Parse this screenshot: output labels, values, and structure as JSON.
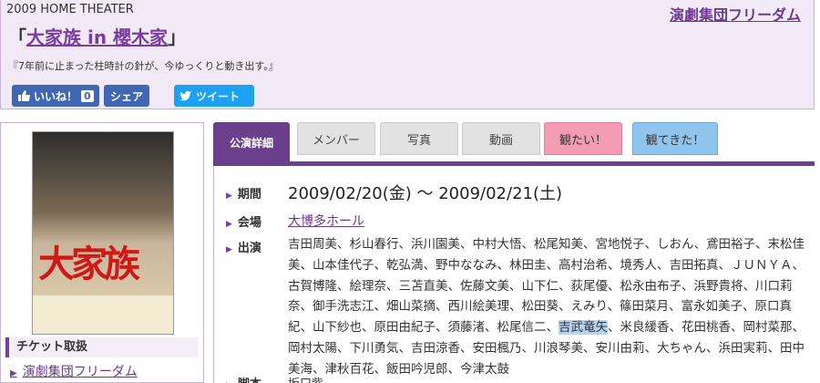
{
  "header": {
    "year_label": "2009 HOME THEATER",
    "title_open": "「",
    "title": "大家族 in 櫻木家",
    "title_close": "」",
    "tagline": "『7年前に止まった柱時計の針が、今ゆっくりと動き出す。』",
    "troupe_link": "演劇集団フリーダム"
  },
  "social": {
    "like_label": "いいね！",
    "like_count": "0",
    "share_label": "シェア",
    "tweet_label": "ツイート",
    "facebook_color": "#4267b2",
    "twitter_color": "#1da1f2"
  },
  "sidebar": {
    "ticket_heading": "チケット取扱",
    "ticket_link": "演劇集団フリーダム",
    "poster_text": "大家族"
  },
  "tabs": [
    {
      "label": "公演詳細"
    },
    {
      "label": "メンバー"
    },
    {
      "label": "写真"
    },
    {
      "label": "動画"
    },
    {
      "label": "観たい！"
    },
    {
      "label": "観てきた！"
    }
  ],
  "details": {
    "period_label": "期間",
    "period_value": "2009/02/20(金) 〜 2009/02/21(土)",
    "venue_label": "会場",
    "venue_value": "大博多ホール",
    "cast_label": "出演",
    "cast_before": "吉田周美、杉山春行、浜川園美、中村大悟、松尾知美、宮地悦子、しおん、鳶田裕子、末松佳美、山本佳代子、乾弘満、野中ななみ、林田圭、高村治希、境秀人、吉田拓真、ＪＵＮＹＡ、古賀博隆、絵理奈、三苫直美、佐藤文美、山下仁、荻尾優、松永由布子、浜野貴将、川口莉奈、御手洗志江、畑山菜摘、西川絵美理、松田葵、えみり、篠田菜月、富永如美子、原口真紀、山下紗也、原田由紀子、須藤渚、松尾信二、",
    "cast_highlight": "吉武竜矢",
    "cast_after": "、米良緩香、花田桃香、岡村菜那、岡村太陽、下川勇気、吉田涼香、安田楓乃、川浪琴美、安川由莉、大ちゃん、浜田実莉、田中美海、津秋百花、飯田吟児郎、今津太鼓",
    "next_label": "脚本",
    "next_value": "坂口紫"
  },
  "colors": {
    "accent": "#6c3f8c",
    "header_bg": "#f1e9f6",
    "link": "#6c3a8e"
  }
}
